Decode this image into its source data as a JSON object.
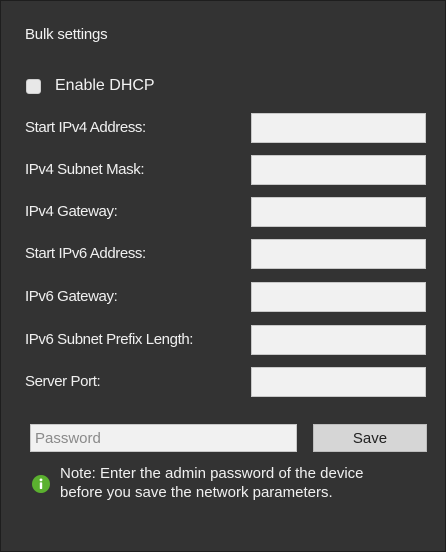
{
  "panel": {
    "title": "Bulk settings"
  },
  "dhcp": {
    "label": "Enable DHCP",
    "checked": false
  },
  "fields": [
    {
      "label": "Start IPv4 Address:",
      "value": ""
    },
    {
      "label": "IPv4 Subnet Mask:",
      "value": ""
    },
    {
      "label": "IPv4 Gateway:",
      "value": ""
    },
    {
      "label": "Start IPv6 Address:",
      "value": ""
    },
    {
      "label": "IPv6 Gateway:",
      "value": ""
    },
    {
      "label": "IPv6 Subnet Prefix Length:",
      "value": ""
    },
    {
      "label": "Server Port:",
      "value": ""
    }
  ],
  "password": {
    "placeholder": "Password",
    "value": ""
  },
  "save_button": {
    "label": "Save"
  },
  "note": {
    "icon": "info-icon",
    "text": "Note: Enter the admin password of the device before you save the network parameters."
  },
  "colors": {
    "background": "#333333",
    "input_background": "#f1f1f1",
    "button_background": "#d6d6d6",
    "info_icon": "#5bb12f"
  }
}
